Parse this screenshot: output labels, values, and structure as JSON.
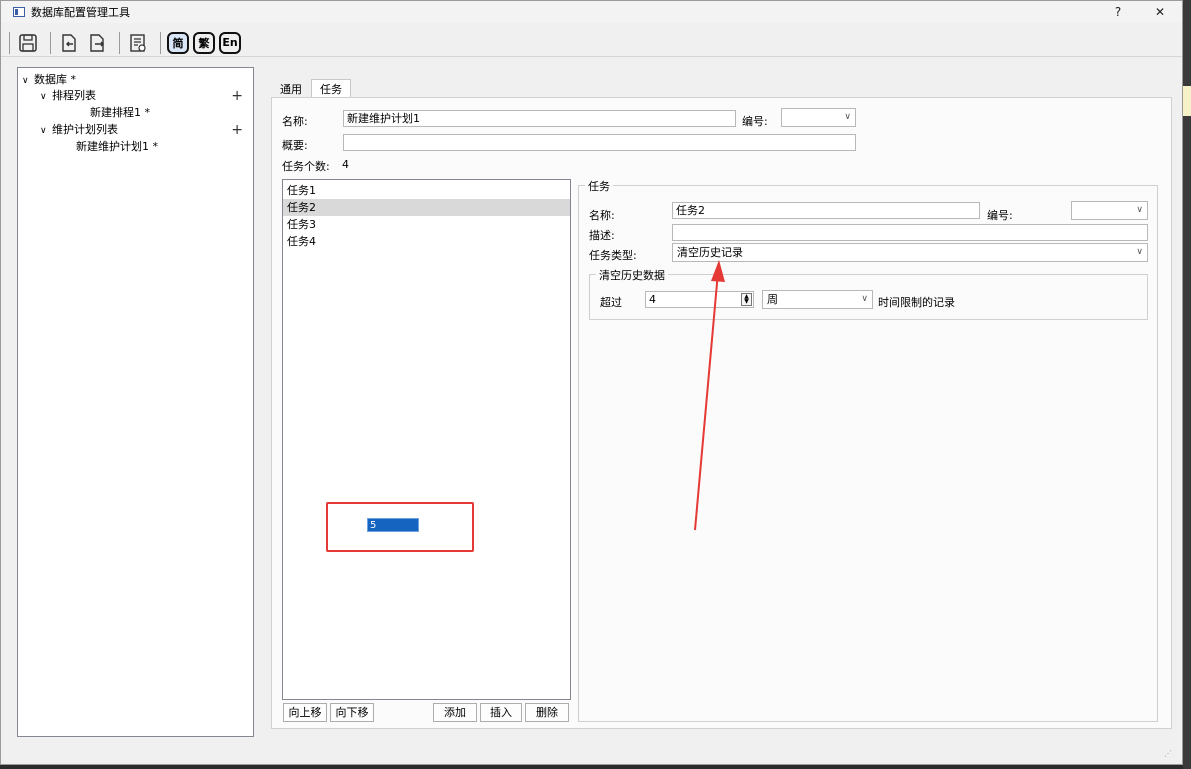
{
  "window": {
    "title": "数据库配置管理工具",
    "help_label": "?",
    "close_label": "✕"
  },
  "toolbar": {
    "lang_simplified": "简",
    "lang_traditional": "繁",
    "lang_english": "En",
    "icons": [
      "save-icon",
      "import-icon",
      "export-icon",
      "preview-icon"
    ]
  },
  "tree": {
    "root": "数据库 *",
    "schedule_list": "排程列表",
    "schedule_item": "新建排程1 *",
    "plan_list": "维护计划列表",
    "plan_item": "新建维护计划1 *",
    "add_label": "+",
    "chevron": "∨"
  },
  "tabs": {
    "general": "通用",
    "tasks": "任务"
  },
  "plan": {
    "name_label": "名称:",
    "name_value": "新建维护计划1",
    "number_label": "编号:",
    "number_value": "",
    "summary_label": "概要:",
    "summary_value": "",
    "task_count_label": "任务个数:",
    "task_count_value": "4"
  },
  "task_list": {
    "items": [
      "任务1",
      "任务2",
      "任务3",
      "任务4"
    ],
    "selected_index": 1,
    "editing_value": "5",
    "move_up": "向上移",
    "move_down": "向下移",
    "add": "添加",
    "insert": "插入",
    "delete": "删除"
  },
  "task_detail": {
    "group_title": "任务",
    "name_label": "名称:",
    "name_value": "任务2",
    "number_label": "编号:",
    "number_value": "",
    "desc_label": "描述:",
    "desc_value": "",
    "type_label": "任务类型:",
    "type_value": "清空历史记录",
    "history_group_title": "清空历史数据",
    "exceed_label": "超过",
    "exceed_value": "4",
    "unit_value": "周",
    "limit_label": "时间限制的记录"
  },
  "colors": {
    "annotation_red": "#e53935",
    "selection_blue": "#1565c0"
  }
}
